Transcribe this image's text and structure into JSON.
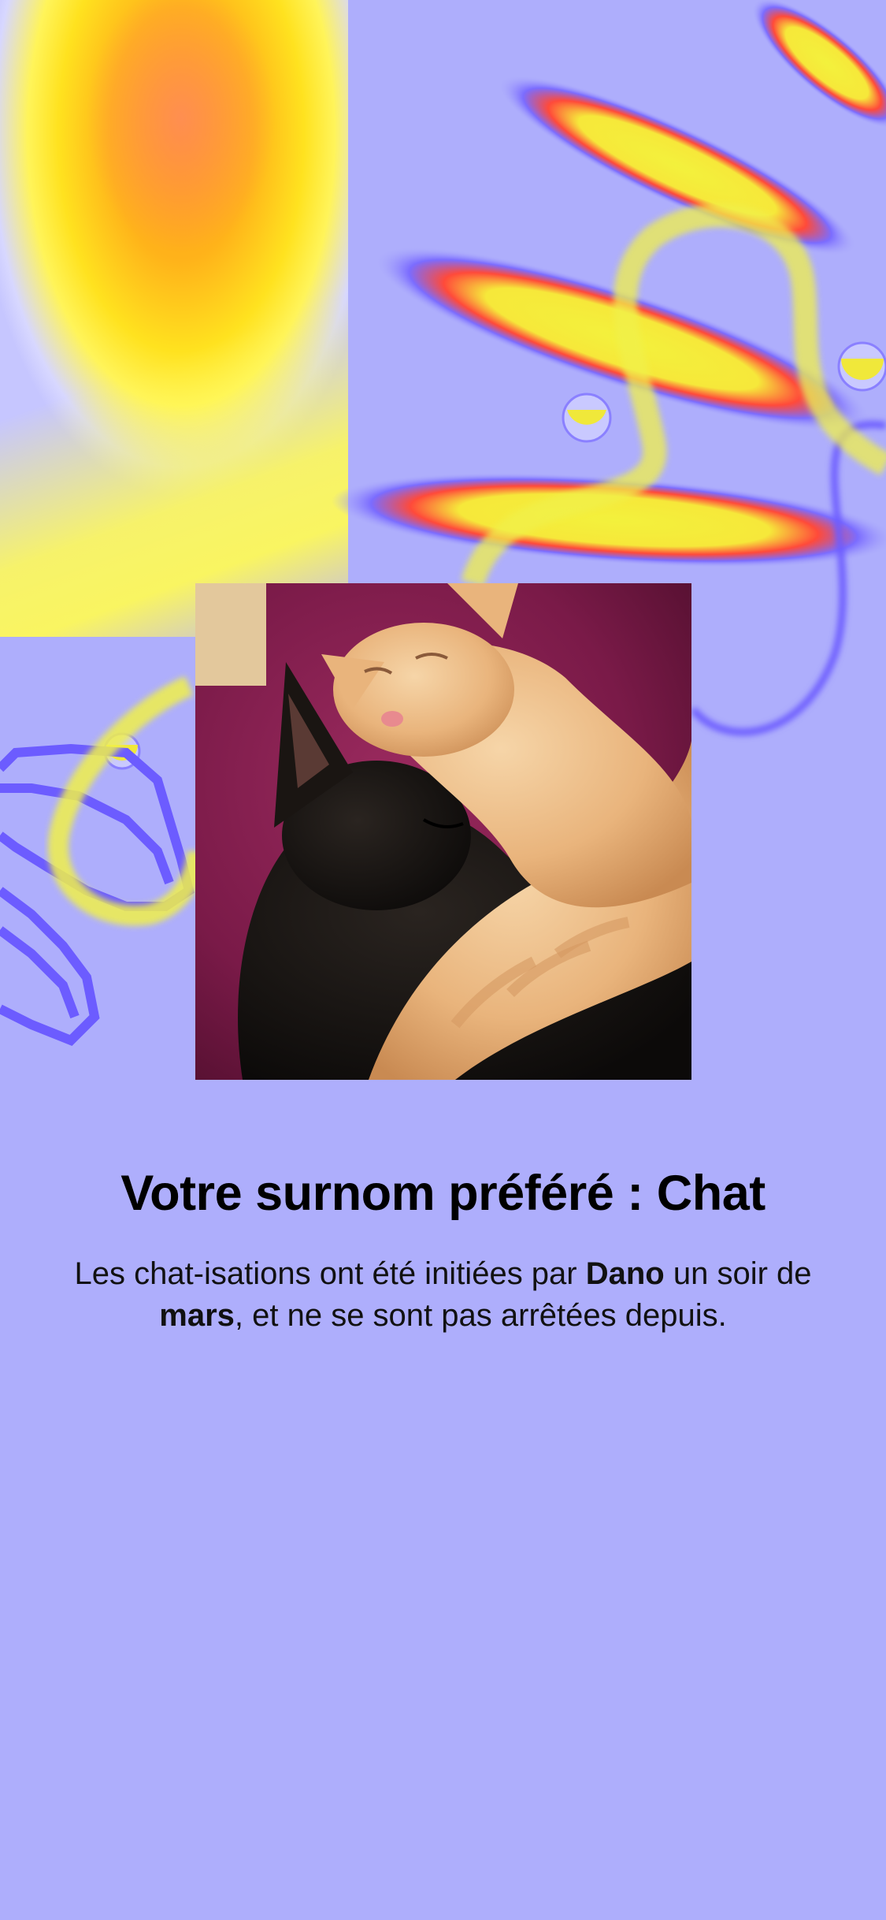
{
  "card": {
    "title": "Votre surnom préféré : Chat",
    "description": {
      "part1": "Les chat-isations ont été initiées par ",
      "name": "Dano",
      "part2": " un soir de ",
      "month": "mars",
      "part3": ", et ne se sont pas arrêtées depuis."
    }
  },
  "photo": {
    "subject": "two sleeping kittens (black and orange) cuddling on a maroon blanket"
  },
  "colors": {
    "background": "#aeaefc",
    "accent_purple": "#6c5cff",
    "accent_yellow": "#f4f04a",
    "accent_red": "#ff4a3a",
    "accent_orange": "#ff9a1a"
  }
}
